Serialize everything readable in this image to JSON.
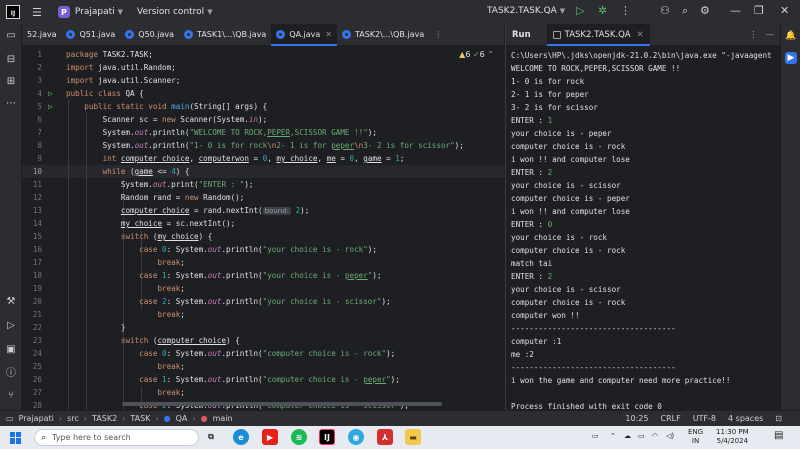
{
  "titlebar": {
    "logo": "IJ",
    "project_badge": "P",
    "project_name": "Prajapati",
    "vcs_label": "Version control",
    "run_config": "TASK2.TASK.QA"
  },
  "tabs": [
    {
      "label": "52.java",
      "active": false
    },
    {
      "label": "Q51.java",
      "active": false
    },
    {
      "label": "Q50.java",
      "active": false
    },
    {
      "label": "TASK1\\...\\QB.java",
      "active": false
    },
    {
      "label": "QA.java",
      "active": true
    },
    {
      "label": "TASK2\\...\\QB.java",
      "active": false
    }
  ],
  "editor": {
    "warnings": "6",
    "checks": "6",
    "param_hint": "bound:",
    "line_numbers": [
      "1",
      "2",
      "3",
      "4",
      "5",
      "6",
      "7",
      "8",
      "9",
      "10",
      "11",
      "12",
      "13",
      "14",
      "15",
      "16",
      "17",
      "18",
      "19",
      "20",
      "21",
      "22",
      "23",
      "24",
      "25",
      "26",
      "27",
      "28"
    ],
    "current_line": "10"
  },
  "run_panel": {
    "title": "Run",
    "tab_label": "TASK2.TASK.QA",
    "console": [
      {
        "text": "C:\\Users\\HP\\.jdks\\openjdk-21.0.2\\bin\\java.exe \"-javaagent",
        "input": false
      },
      {
        "text": "WELCOME TO ROCK,PEPER,SCISSOR GAME !!",
        "input": false
      },
      {
        "text": "1- 0 is for rock",
        "input": false
      },
      {
        "text": "2- 1 is for peper",
        "input": false
      },
      {
        "text": "3- 2 is for scissor",
        "input": false
      },
      {
        "text": "ENTER : ",
        "input": false,
        "value": "1"
      },
      {
        "text": "your choice is - peper",
        "input": false
      },
      {
        "text": "computer choice is - rock",
        "input": false
      },
      {
        "text": "i won !! and computer lose",
        "input": false
      },
      {
        "text": "ENTER : ",
        "input": false,
        "value": "2"
      },
      {
        "text": "your choice is - scissor",
        "input": false
      },
      {
        "text": "computer choice is - peper",
        "input": false
      },
      {
        "text": "i won !! and computer lose",
        "input": false
      },
      {
        "text": "ENTER : ",
        "input": false,
        "value": "0"
      },
      {
        "text": "your choice is - rock",
        "input": false
      },
      {
        "text": "computer choice is - rock",
        "input": false
      },
      {
        "text": "match tai",
        "input": false
      },
      {
        "text": "ENTER : ",
        "input": false,
        "value": "2"
      },
      {
        "text": "your choice is - scissor",
        "input": false
      },
      {
        "text": "computer choice is - rock",
        "input": false
      },
      {
        "text": "computer won !!",
        "input": false
      },
      {
        "text": "------------------------------------",
        "input": false
      },
      {
        "text": "computer :1",
        "input": false
      },
      {
        "text": "me :2",
        "input": false
      },
      {
        "text": "------------------------------------",
        "input": false
      },
      {
        "text": "i won the game and computer need more practice!!",
        "input": false
      },
      {
        "text": "",
        "input": false
      },
      {
        "text": "Process finished with exit code 0",
        "input": false
      }
    ]
  },
  "statusbar": {
    "breadcrumb": [
      "Prajapati",
      "src",
      "TASK2",
      "TASK",
      "QA",
      "main"
    ],
    "position": "10:25",
    "line_sep": "CRLF",
    "encoding": "UTF-8",
    "indent": "4 spaces"
  },
  "taskbar": {
    "search_placeholder": "Type here to search",
    "lang": "ENG",
    "region": "IN",
    "time": "11:30 PM",
    "date": "5/4/2024"
  }
}
